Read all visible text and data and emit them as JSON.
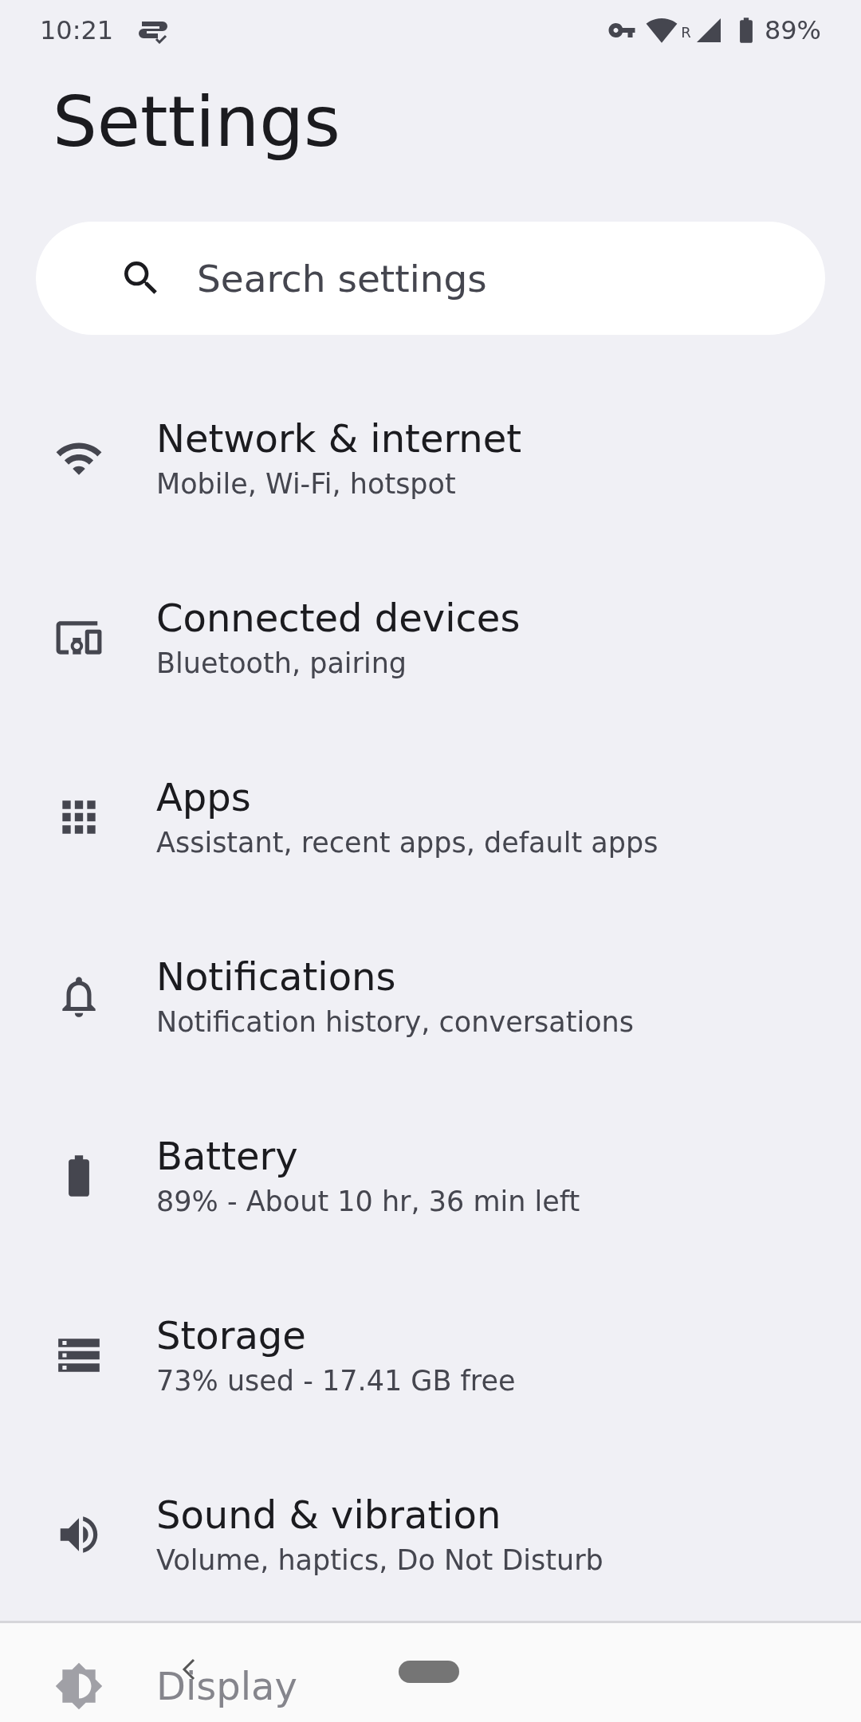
{
  "status_bar": {
    "time": "10:21",
    "roaming": "R",
    "battery": "89%"
  },
  "title": "Settings",
  "search": {
    "placeholder": "Search settings"
  },
  "items": [
    {
      "title": "Network & internet",
      "subtitle": "Mobile, Wi-Fi, hotspot"
    },
    {
      "title": "Connected devices",
      "subtitle": "Bluetooth, pairing"
    },
    {
      "title": "Apps",
      "subtitle": "Assistant, recent apps, default apps"
    },
    {
      "title": "Notifications",
      "subtitle": "Notification history, conversations"
    },
    {
      "title": "Battery",
      "subtitle": "89% - About 10 hr, 36 min left"
    },
    {
      "title": "Storage",
      "subtitle": "73% used - 17.41 GB free"
    },
    {
      "title": "Sound & vibration",
      "subtitle": "Volume, haptics, Do Not Disturb"
    },
    {
      "title": "Display"
    }
  ]
}
